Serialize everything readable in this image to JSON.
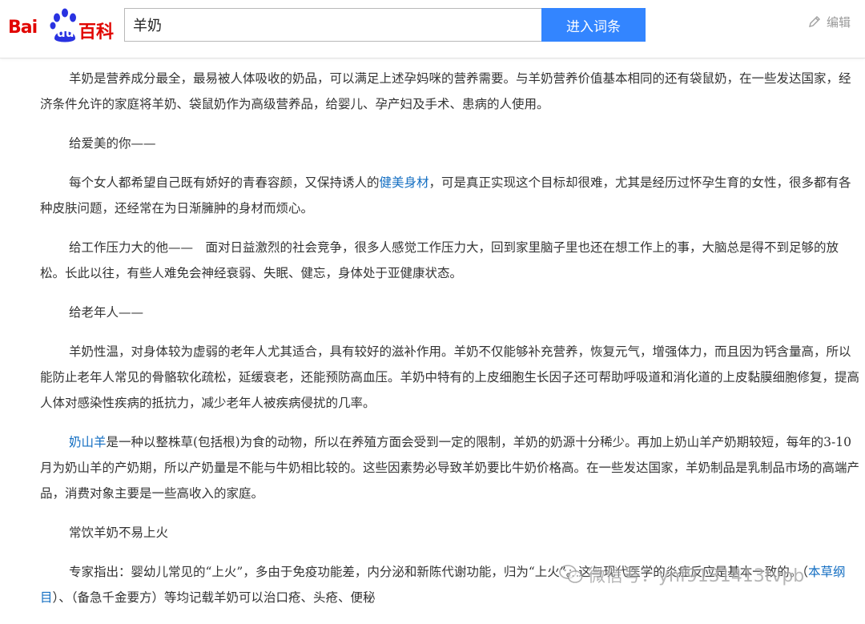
{
  "header": {
    "logo": {
      "bai": "Bai",
      "du": "du",
      "baike": "百科"
    },
    "search": {
      "value": "羊奶",
      "button_label": "进入词条"
    },
    "edit_label": "编辑"
  },
  "article": {
    "p1": "羊奶是营养成分最全，最易被人体吸收的奶品，可以满足上述孕妈咪的营养需要。与羊奶营养价值基本相同的还有袋鼠奶，在一些发达国家，经济条件允许的家庭将羊奶、袋鼠奶作为高级营养品，给婴儿、孕产妇及手术、患病的人使用。",
    "h_beauty": "给爱美的你——",
    "p2_before": "每个女人都希望自己既有娇好的青春容颜，又保持诱人的",
    "p2_link": "健美身材",
    "p2_after": "，可是真正实现这个目标却很难，尤其是经历过怀孕生育的女性，很多都有各种皮肤问题，还经常在为日渐臃肿的身材而烦心。",
    "p3": "给工作压力大的他——　面对日益激烈的社会竞争，很多人感觉工作压力大，回到家里脑子里也还在想工作上的事，大脑总是得不到足够的放松。长此以往，有些人难免会神经衰弱、失眠、健忘，身体处于亚健康状态。",
    "h_elder": "给老年人——",
    "p4": "羊奶性温，对身体较为虚弱的老年人尤其适合，具有较好的滋补作用。羊奶不仅能够补充营养，恢复元气，增强体力，而且因为钙含量高，所以能防止老年人常见的骨骼软化疏松，延缓衰老，还能预防高血压。羊奶中特有的上皮细胞生长因子还可帮助呼吸道和消化道的上皮黏膜细胞修复，提高人体对感染性疾病的抵抗力，减少老年人被疾病侵扰的几率。",
    "p5_link": "奶山羊",
    "p5_after": "是一种以整株草(包括根)为食的动物，所以在养殖方面会受到一定的限制，羊奶的奶源十分稀少。再加上奶山羊产奶期较短，每年的3-10月为奶山羊的产奶期，所以产奶量是不能与牛奶相比较的。这些因素势必导致羊奶要比牛奶价格高。在一些发达国家，羊奶制品是乳制品市场的高端产品，消费对象主要是一些高收入的家庭。",
    "h_fire": "常饮羊奶不易上火",
    "p6_before": "专家指出：婴幼儿常见的“上火”，多由于免疫功能差，内分泌和新陈代谢功能",
    "p6_mid": "，归为“上火”。这与现代医学的炎症反应是基本一致的。（",
    "p6_link": "本草纲目",
    "p6_after": "）、（备急千金要方）等均记载羊奶可以治口疮、头疮、便秘"
  },
  "watermark": "微信号：ynf9131413tvpb"
}
